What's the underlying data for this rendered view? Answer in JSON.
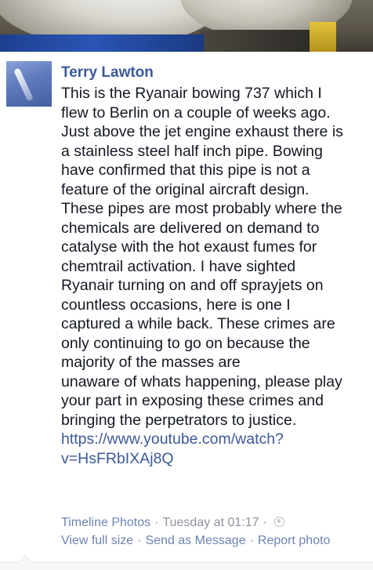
{
  "photo": {
    "alt": "aircraft engine photo"
  },
  "post": {
    "author": "Terry Lawton",
    "lines": [
      "This is the Ryanair bowing 737 which I",
      "flew to Berlin on a couple of weeks ago.",
      "Just above the jet engine exhaust there is",
      "a stainless steel half inch pipe. Bowing",
      "have confirmed that this pipe is not a",
      "feature of the original aircraft design.",
      "These pipes are most probably where the",
      "chemicals are delivered on demand to",
      "catalyse with the hot exaust fumes for",
      "chemtrail activation. I have sighted",
      "Ryanair turning on and off sprayjets on",
      "countless occasions, here is one I",
      "captured a while back. These crimes are",
      "only continuing to go on because the",
      "majority of the masses are",
      "unaware of whats happening, please play",
      "your part in exposing these crimes and",
      "bringing the perpetrators to justice."
    ],
    "link_line1": "https://www.youtube.com/watch?",
    "link_line2": "v=HsFRbIXAj8Q"
  },
  "meta": {
    "timeline_photos": "Timeline Photos",
    "timestamp": "Tuesday at 01:17",
    "view_full_size": "View full size",
    "send_as_message": "Send as Message",
    "report_photo": "Report photo",
    "separator": "·",
    "privacy_icon": "globe-icon"
  },
  "colors": {
    "author": "#3b5998",
    "link": "#3b5998",
    "meta_link": "#6d84b4",
    "meta_text": "#90949c",
    "body_text": "#141823"
  }
}
